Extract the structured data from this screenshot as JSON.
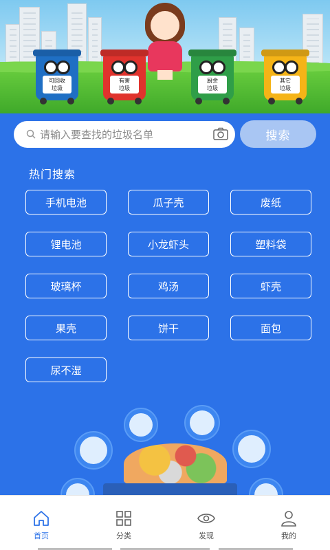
{
  "banner": {
    "bins": [
      {
        "label_line1": "可回收",
        "label_line2": "垃圾",
        "color": "#1f6fc4"
      },
      {
        "label_line1": "有害",
        "label_line2": "垃圾",
        "color": "#e0332d"
      },
      {
        "label_line1": "厨余",
        "label_line2": "垃圾",
        "color": "#2f9e48"
      },
      {
        "label_line1": "其它",
        "label_line2": "垃圾",
        "color": "#f5b417"
      }
    ]
  },
  "search": {
    "placeholder": "请输入要查找的垃圾名单",
    "button_label": "搜索"
  },
  "hot": {
    "title": "热门搜索",
    "items": [
      "手机电池",
      "瓜子壳",
      "废纸",
      "锂电池",
      "小龙虾头",
      "塑料袋",
      "玻璃杯",
      "鸡汤",
      "虾壳",
      "果壳",
      "饼干",
      "面包",
      "尿不湿"
    ]
  },
  "tabs": [
    {
      "label": "首页",
      "icon": "home-icon",
      "active": true
    },
    {
      "label": "分类",
      "icon": "grid-icon",
      "active": false
    },
    {
      "label": "发现",
      "icon": "eye-icon",
      "active": false
    },
    {
      "label": "我的",
      "icon": "user-icon",
      "active": false
    }
  ],
  "colors": {
    "background": "#2c72e8",
    "search_button": "#a9c6f3",
    "active_tab": "#2c72e8"
  }
}
